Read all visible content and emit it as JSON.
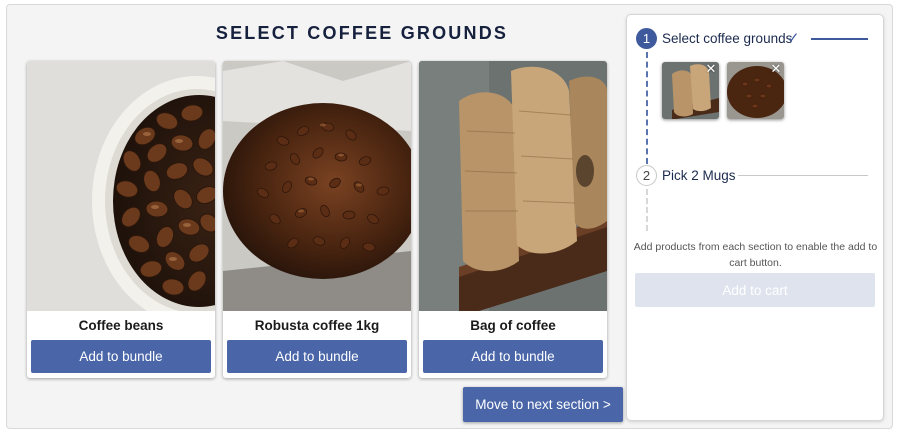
{
  "section_title": "SELECT COFFEE GROUNDS",
  "products": [
    {
      "name": "Coffee beans",
      "button_label": "Add to bundle",
      "image": "cup-of-coffee-beans-photo"
    },
    {
      "name": "Robusta coffee 1kg",
      "button_label": "Add to bundle",
      "image": "open-bag-of-coffee-beans-photo"
    },
    {
      "name": "Bag of coffee",
      "button_label": "Add to bundle",
      "image": "burlap-coffee-sacks-photo"
    }
  ],
  "next_button_label": "Move to next section >",
  "bundle_panel": {
    "steps": [
      {
        "number": "1",
        "label": "Select coffee grounds",
        "completed": true,
        "check_icon": "checkmark-icon"
      },
      {
        "number": "2",
        "label": "Pick 2 Mugs",
        "completed": false
      }
    ],
    "selected_items": [
      {
        "image": "burlap-coffee-sacks-thumbnail",
        "remove_icon": "close-icon"
      },
      {
        "image": "coffee-beans-thumbnail",
        "remove_icon": "close-icon"
      }
    ],
    "hint_text": "Add products from each section to enable the add to cart button.",
    "cart_button_label": "Add to cart",
    "cart_button_enabled": false
  },
  "colors": {
    "primary": "#4a66a8",
    "title": "#16213e",
    "step_active": "#3e5a9c",
    "disabled_button": "#dfe3ee",
    "background": "#f4f4f4"
  }
}
